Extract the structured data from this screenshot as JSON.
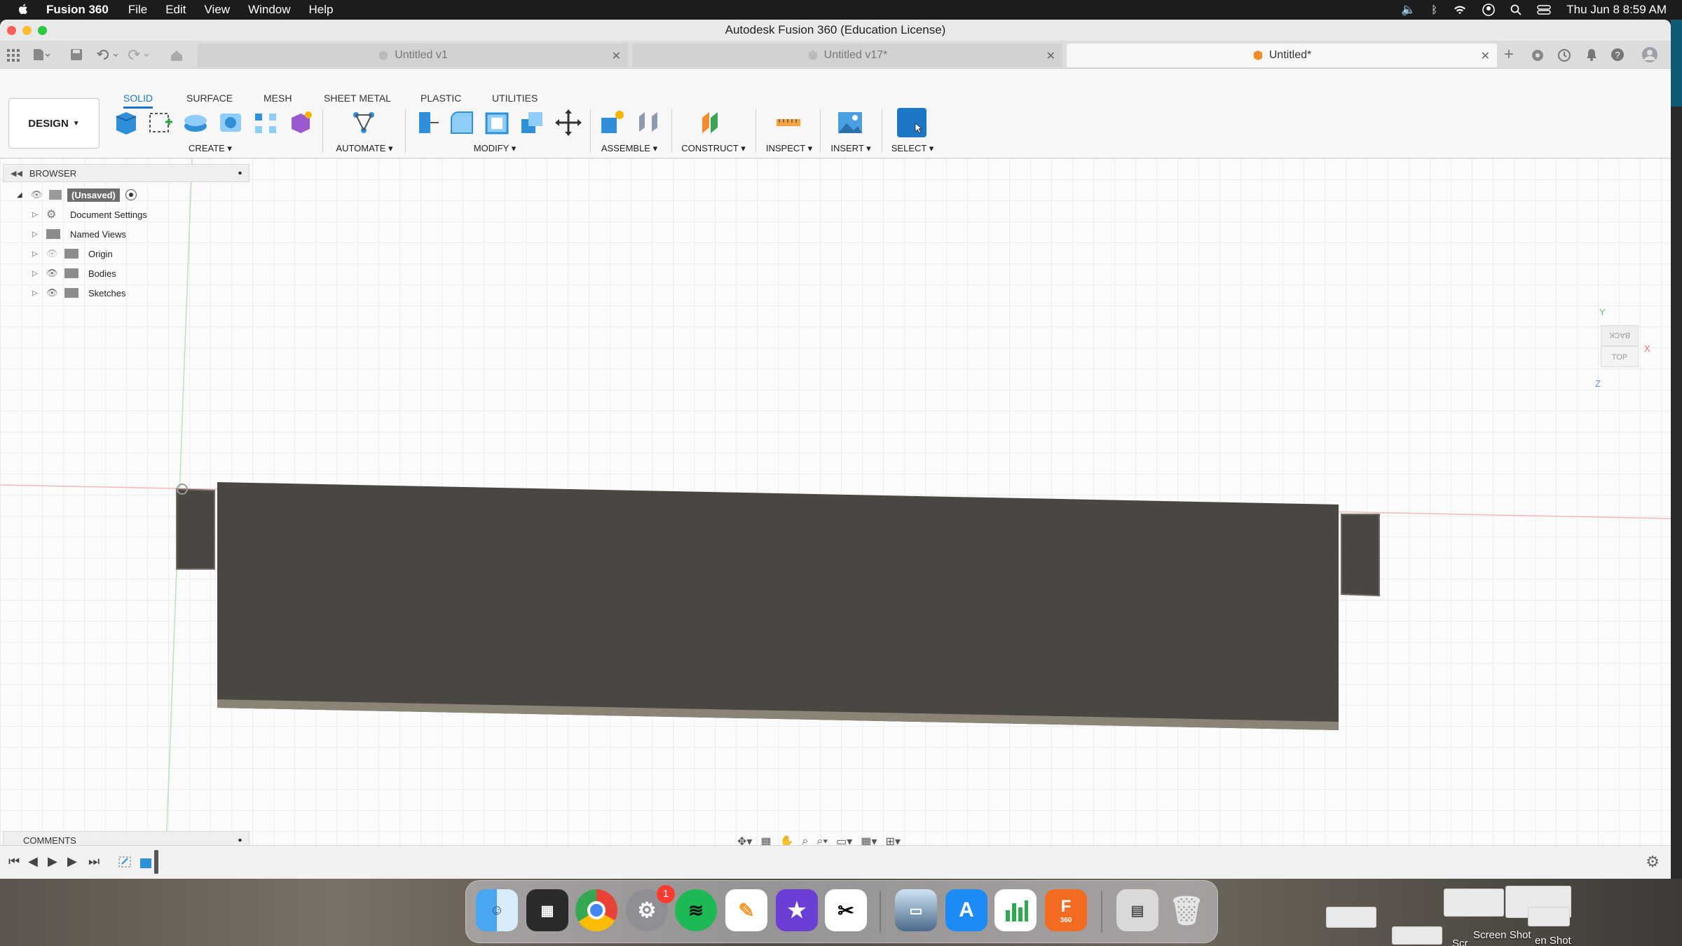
{
  "menubar": {
    "app_name": "Fusion 360",
    "menus": [
      "File",
      "Edit",
      "View",
      "Window",
      "Help"
    ],
    "datetime": "Thu Jun 8  8:59 AM"
  },
  "window": {
    "title": "Autodesk Fusion 360 (Education License)"
  },
  "tabs": [
    {
      "label": "Untitled v1"
    },
    {
      "label": "Untitled v17*"
    },
    {
      "label": "Untitled*"
    }
  ],
  "ribbon": {
    "workspace": "DESIGN",
    "workspace_tabs": [
      "SOLID",
      "SURFACE",
      "MESH",
      "SHEET METAL",
      "PLASTIC",
      "UTILITIES"
    ],
    "groups": [
      "CREATE",
      "AUTOMATE",
      "MODIFY",
      "ASSEMBLE",
      "CONSTRUCT",
      "INSPECT",
      "INSERT",
      "SELECT"
    ]
  },
  "browser": {
    "title": "BROWSER",
    "items": [
      {
        "label": "(Unsaved)"
      },
      {
        "label": "Document Settings"
      },
      {
        "label": "Named Views"
      },
      {
        "label": "Origin"
      },
      {
        "label": "Bodies"
      },
      {
        "label": "Sketches"
      }
    ]
  },
  "viewcube": {
    "faces": [
      "BACK",
      "TOP"
    ],
    "axes": [
      "Y",
      "X",
      "Z"
    ]
  },
  "comments": {
    "title": "COMMENTS"
  },
  "dock": {
    "fusion_label": "360",
    "settings_badge": "1"
  },
  "desktop": {
    "screenshot_labels": [
      "Screen Shot",
      "en Shot",
      "Scr"
    ]
  },
  "colors": {
    "accent": "#1c78c7",
    "body_fill": "#4a4742",
    "body_edge": "#8a8376"
  }
}
